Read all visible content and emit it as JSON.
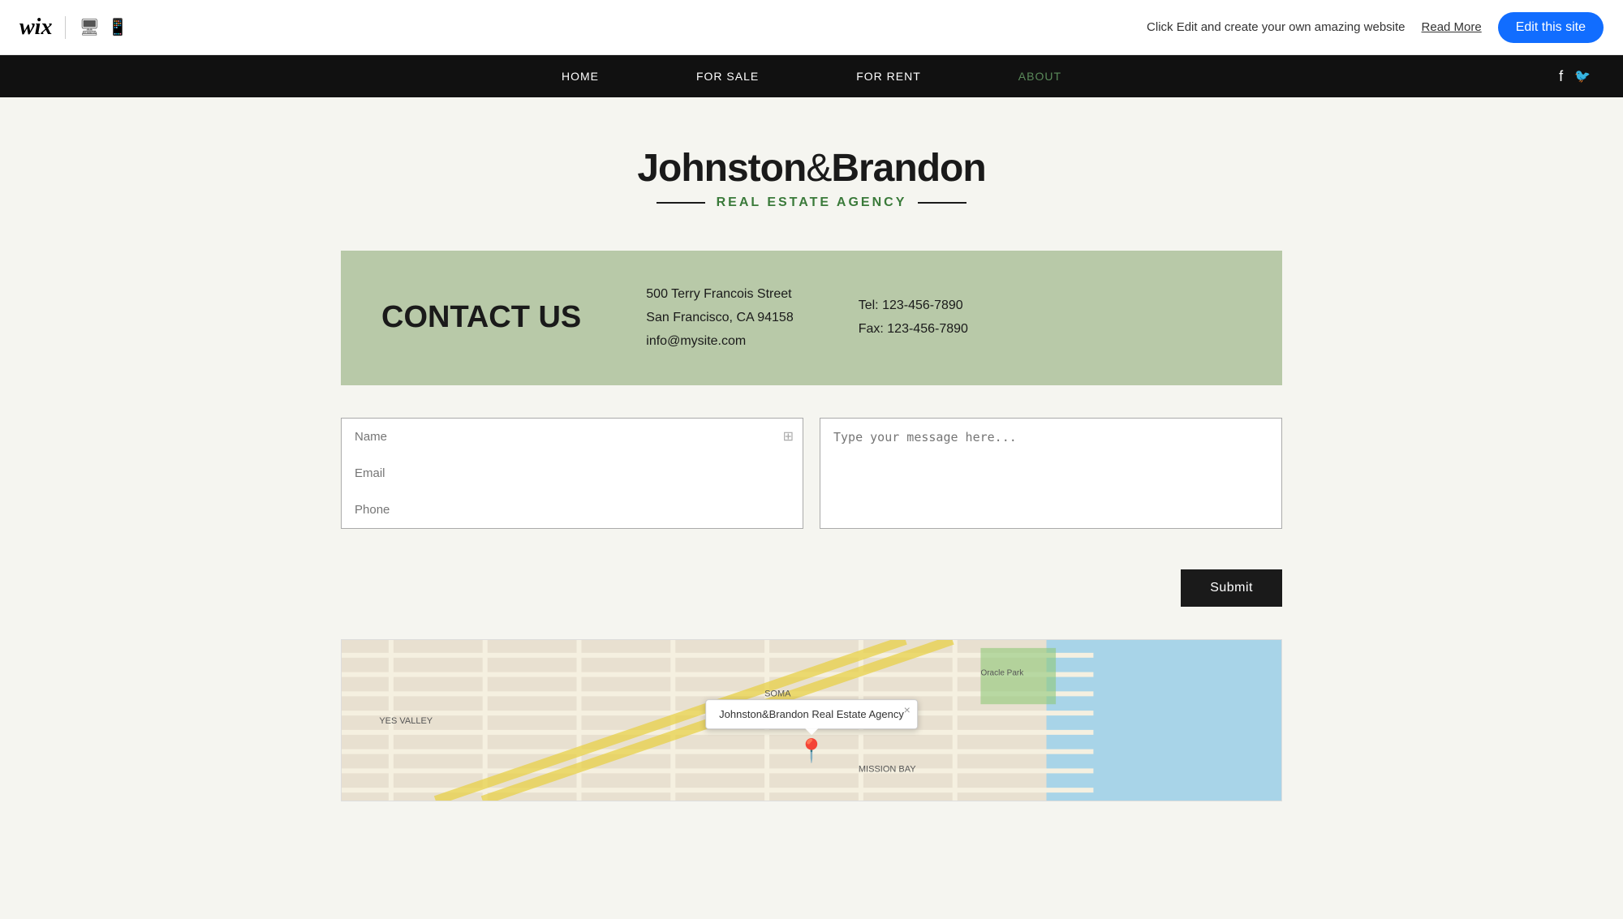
{
  "topbar": {
    "wix_logo": "wix",
    "promo_text": "Click Edit and create your own amazing website",
    "read_more_label": "Read More",
    "edit_btn_label": "Edit this site"
  },
  "nav": {
    "items": [
      {
        "label": "HOME",
        "active": false
      },
      {
        "label": "FOR SALE",
        "active": false
      },
      {
        "label": "FOR RENT",
        "active": false
      },
      {
        "label": "ABOUT",
        "active": true
      }
    ],
    "social": [
      "facebook",
      "twitter"
    ]
  },
  "site": {
    "title_part1": "Johnston",
    "title_ampersand": "&",
    "title_part2": "Brandon",
    "subtitle": "Real Estate Agency"
  },
  "contact": {
    "heading": "CONTACT US",
    "address_line1": "500 Terry Francois Street",
    "address_line2": "San Francisco, CA  94158",
    "email": "info@mysite.com",
    "tel": "Tel: 123-456-7890",
    "fax": "Fax: 123-456-7890"
  },
  "form": {
    "name_placeholder": "Name",
    "email_placeholder": "Email",
    "phone_placeholder": "Phone",
    "message_placeholder": "Type your message here...",
    "submit_label": "Submit"
  },
  "map": {
    "popup_label": "Johnston&Brandon Real Estate Agency",
    "close_label": "×"
  }
}
